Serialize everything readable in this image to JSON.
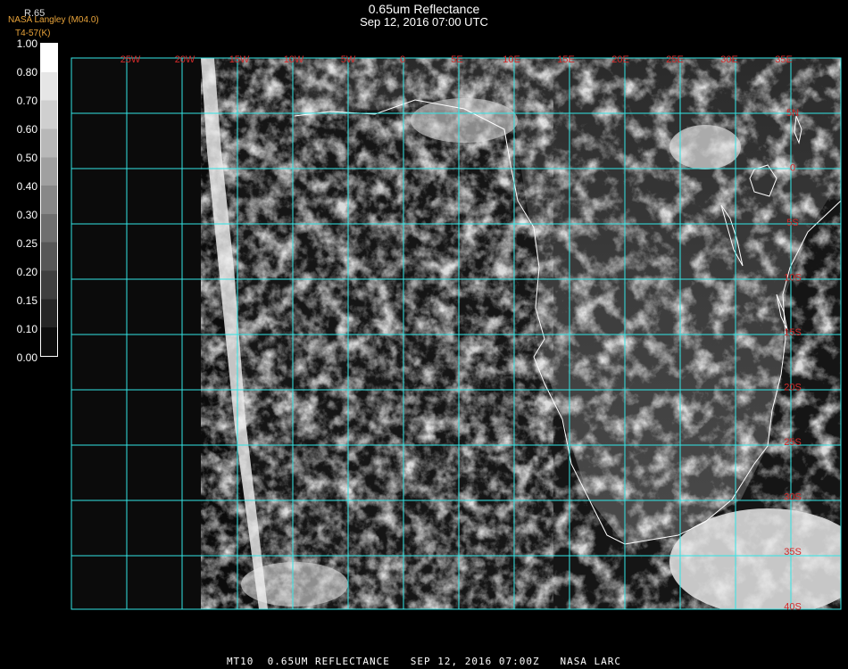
{
  "header": {
    "title": "0.65um Reflectance",
    "subtitle": "Sep 12, 2016 07:00 UTC",
    "credit": "NASA Langley (M04.0)",
    "credit2": "T4-57(K)",
    "scale_head": "R.65"
  },
  "colorbar": {
    "labels": [
      "1.00",
      "0.80",
      "0.70",
      "0.60",
      "0.50",
      "0.40",
      "0.30",
      "0.25",
      "0.20",
      "0.15",
      "0.10",
      "0.00"
    ]
  },
  "map": {
    "lon_labels": [
      "25W",
      "20W",
      "15W",
      "10W",
      "5W",
      "0",
      "5E",
      "10E",
      "15E",
      "20E",
      "25E",
      "30E",
      "35E"
    ],
    "lat_labels": [
      "5N",
      "0",
      "5S",
      "10S",
      "15S",
      "20S",
      "25S",
      "30S",
      "35S",
      "40S"
    ],
    "grid_color": "#33e5e5",
    "label_color": "#d42a2a",
    "coast_color": "#ffffff"
  },
  "footer": {
    "text": "MT10  0.65UM REFLECTANCE   SEP 12, 2016 07:00Z   NASA LARC"
  }
}
